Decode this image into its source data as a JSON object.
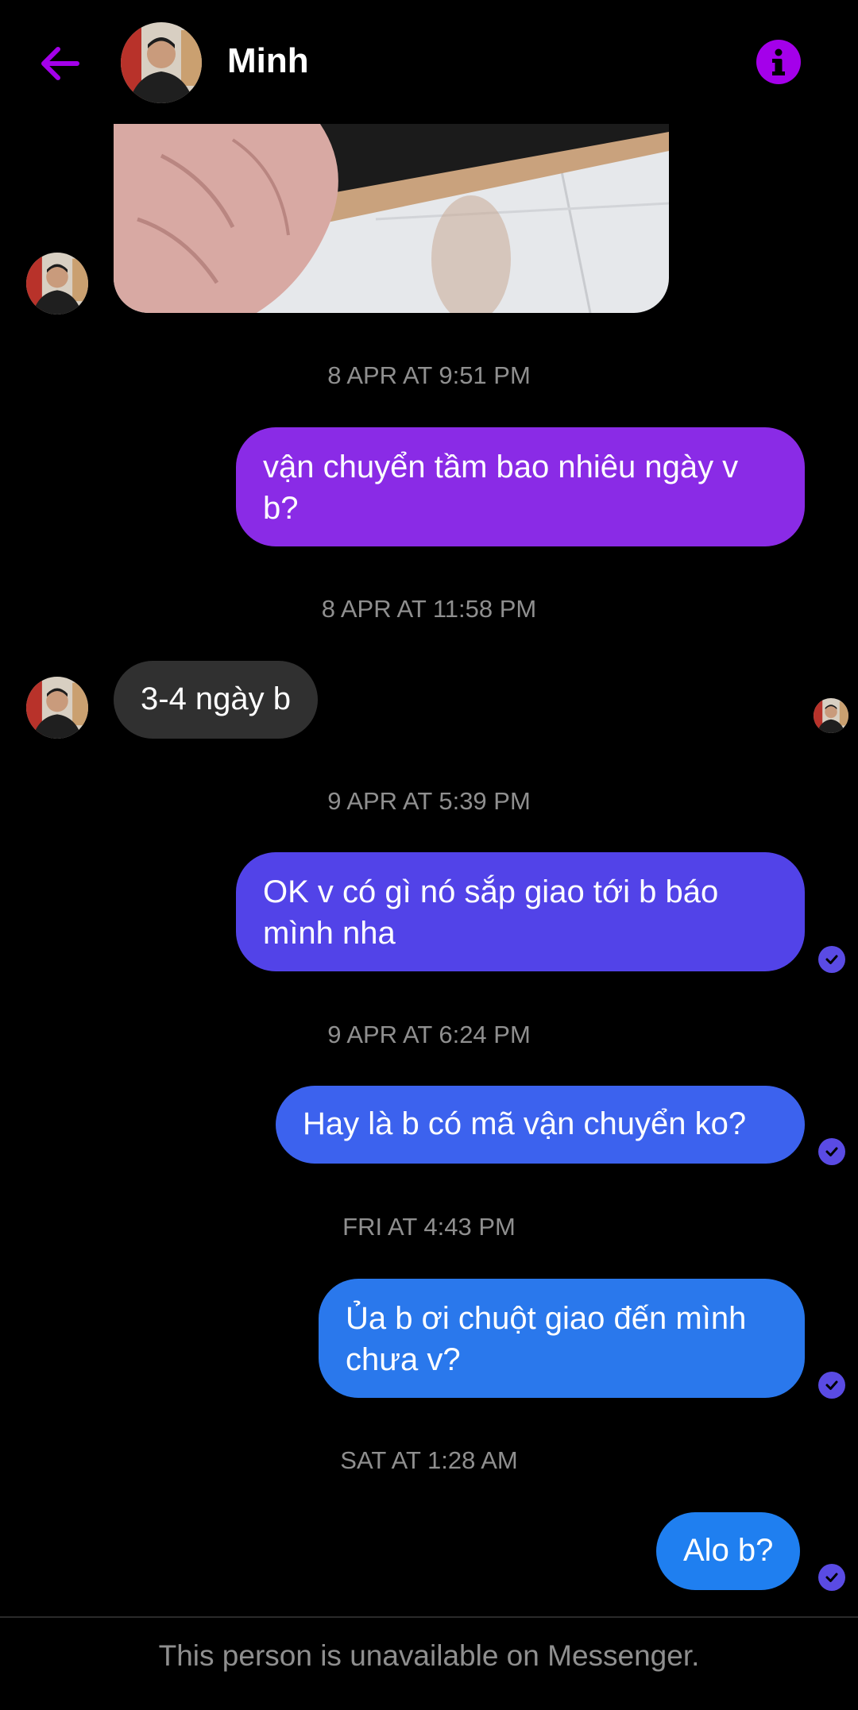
{
  "header": {
    "contact_name": "Minh",
    "back_icon": "arrow-left-icon",
    "info_icon": "info-icon",
    "accent_color": "#a400ea"
  },
  "messages": [
    {
      "type": "image",
      "direction": "incoming"
    },
    {
      "type": "timestamp",
      "text": "8 APR AT 9:51 PM"
    },
    {
      "type": "text",
      "direction": "outgoing",
      "text": "vận chuyển tầm bao nhiêu ngày v b?",
      "color": "#8a2be6"
    },
    {
      "type": "timestamp",
      "text": "8 APR AT 11:58 PM"
    },
    {
      "type": "text",
      "direction": "incoming",
      "text": "3-4 ngày b",
      "color": "#303030"
    },
    {
      "type": "timestamp",
      "text": "9 APR AT 5:39 PM"
    },
    {
      "type": "text",
      "direction": "outgoing",
      "text": "OK v có gì nó sắp giao tới b báo mình nha",
      "color": "#5243e8"
    },
    {
      "type": "timestamp",
      "text": "9 APR AT 6:24 PM"
    },
    {
      "type": "text",
      "direction": "outgoing",
      "text": "Hay là b có mã vận chuyển ko?",
      "color": "#3c62ee"
    },
    {
      "type": "timestamp",
      "text": "FRI AT 4:43 PM"
    },
    {
      "type": "text",
      "direction": "outgoing",
      "text": "Ủa b ơi chuột giao đến mình chưa v?",
      "color": "#2a78ec"
    },
    {
      "type": "timestamp",
      "text": "SAT AT 1:28 AM"
    },
    {
      "type": "text",
      "direction": "outgoing",
      "text": "Alo b?",
      "color": "#1f7ff0"
    }
  ],
  "read_receipt_color": "#5a4be4",
  "footer": {
    "notice": "This person is unavailable on Messenger."
  }
}
